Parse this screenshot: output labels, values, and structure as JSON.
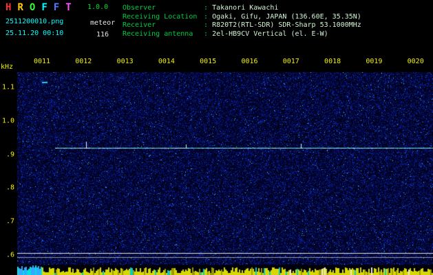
{
  "app": {
    "logo_letters": [
      {
        "char": "H",
        "color": "#ff3333"
      },
      {
        "char": "R",
        "color": "#ffcc00"
      },
      {
        "char": "O",
        "color": "#33ff33"
      },
      {
        "char": "F",
        "color": "#00ffff"
      },
      {
        "char": "F",
        "color": "#5577ff"
      },
      {
        "char": "T",
        "color": "#ff55ff"
      }
    ],
    "version": "1.0.0",
    "filename": "2511200010.png",
    "mode": "meteor",
    "datetime": "25.11.20 00:10",
    "count": "116"
  },
  "info": {
    "separator": ":",
    "rows": [
      {
        "label": "Observer",
        "value": "Takanori Kawachi"
      },
      {
        "label": "Receiving Location",
        "value": "Ogaki, Gifu, JAPAN (136.60E, 35.35N)"
      },
      {
        "label": "Receiver",
        "value": "R820T2(RTL-SDR) SDR-Sharp 53.1000MHz"
      },
      {
        "label": "Receiving antenna",
        "value": "2el-HB9CV Vertical (el. E-W)"
      }
    ]
  },
  "spectrogram": {
    "x_axis_labels": [
      "0011",
      "0012",
      "0013",
      "0014",
      "0015",
      "0016",
      "0017",
      "0018",
      "0019",
      "0020"
    ],
    "y_axis_unit": "kHz",
    "y_axis_labels": [
      "1.1",
      "1.0",
      ".9",
      ".8",
      ".7",
      ".6"
    ],
    "carrier_line_khz": 0.92,
    "colors": {
      "axis_labels": "#f0f000",
      "noise_base": "#000040",
      "carrier_line": "#9ffff4",
      "level_bars": "#d8d800",
      "level_bars_alt": "#00cccc"
    }
  }
}
